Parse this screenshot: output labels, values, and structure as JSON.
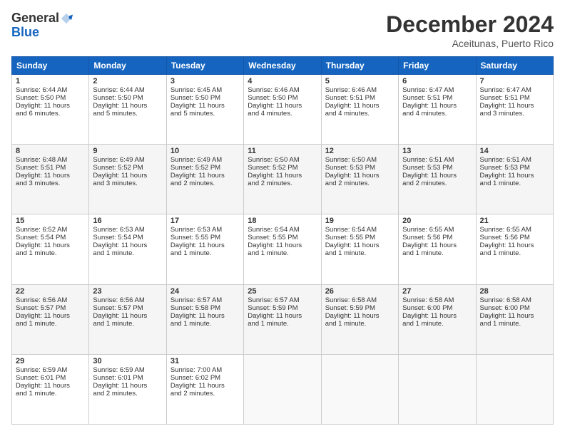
{
  "logo": {
    "general": "General",
    "blue": "Blue"
  },
  "header": {
    "month_year": "December 2024",
    "location": "Aceitunas, Puerto Rico"
  },
  "weekdays": [
    "Sunday",
    "Monday",
    "Tuesday",
    "Wednesday",
    "Thursday",
    "Friday",
    "Saturday"
  ],
  "weeks": [
    [
      {
        "day": "1",
        "lines": [
          "Sunrise: 6:44 AM",
          "Sunset: 5:50 PM",
          "Daylight: 11 hours",
          "and 6 minutes."
        ]
      },
      {
        "day": "2",
        "lines": [
          "Sunrise: 6:44 AM",
          "Sunset: 5:50 PM",
          "Daylight: 11 hours",
          "and 5 minutes."
        ]
      },
      {
        "day": "3",
        "lines": [
          "Sunrise: 6:45 AM",
          "Sunset: 5:50 PM",
          "Daylight: 11 hours",
          "and 5 minutes."
        ]
      },
      {
        "day": "4",
        "lines": [
          "Sunrise: 6:46 AM",
          "Sunset: 5:50 PM",
          "Daylight: 11 hours",
          "and 4 minutes."
        ]
      },
      {
        "day": "5",
        "lines": [
          "Sunrise: 6:46 AM",
          "Sunset: 5:51 PM",
          "Daylight: 11 hours",
          "and 4 minutes."
        ]
      },
      {
        "day": "6",
        "lines": [
          "Sunrise: 6:47 AM",
          "Sunset: 5:51 PM",
          "Daylight: 11 hours",
          "and 4 minutes."
        ]
      },
      {
        "day": "7",
        "lines": [
          "Sunrise: 6:47 AM",
          "Sunset: 5:51 PM",
          "Daylight: 11 hours",
          "and 3 minutes."
        ]
      }
    ],
    [
      {
        "day": "8",
        "lines": [
          "Sunrise: 6:48 AM",
          "Sunset: 5:51 PM",
          "Daylight: 11 hours",
          "and 3 minutes."
        ]
      },
      {
        "day": "9",
        "lines": [
          "Sunrise: 6:49 AM",
          "Sunset: 5:52 PM",
          "Daylight: 11 hours",
          "and 3 minutes."
        ]
      },
      {
        "day": "10",
        "lines": [
          "Sunrise: 6:49 AM",
          "Sunset: 5:52 PM",
          "Daylight: 11 hours",
          "and 2 minutes."
        ]
      },
      {
        "day": "11",
        "lines": [
          "Sunrise: 6:50 AM",
          "Sunset: 5:52 PM",
          "Daylight: 11 hours",
          "and 2 minutes."
        ]
      },
      {
        "day": "12",
        "lines": [
          "Sunrise: 6:50 AM",
          "Sunset: 5:53 PM",
          "Daylight: 11 hours",
          "and 2 minutes."
        ]
      },
      {
        "day": "13",
        "lines": [
          "Sunrise: 6:51 AM",
          "Sunset: 5:53 PM",
          "Daylight: 11 hours",
          "and 2 minutes."
        ]
      },
      {
        "day": "14",
        "lines": [
          "Sunrise: 6:51 AM",
          "Sunset: 5:53 PM",
          "Daylight: 11 hours",
          "and 1 minute."
        ]
      }
    ],
    [
      {
        "day": "15",
        "lines": [
          "Sunrise: 6:52 AM",
          "Sunset: 5:54 PM",
          "Daylight: 11 hours",
          "and 1 minute."
        ]
      },
      {
        "day": "16",
        "lines": [
          "Sunrise: 6:53 AM",
          "Sunset: 5:54 PM",
          "Daylight: 11 hours",
          "and 1 minute."
        ]
      },
      {
        "day": "17",
        "lines": [
          "Sunrise: 6:53 AM",
          "Sunset: 5:55 PM",
          "Daylight: 11 hours",
          "and 1 minute."
        ]
      },
      {
        "day": "18",
        "lines": [
          "Sunrise: 6:54 AM",
          "Sunset: 5:55 PM",
          "Daylight: 11 hours",
          "and 1 minute."
        ]
      },
      {
        "day": "19",
        "lines": [
          "Sunrise: 6:54 AM",
          "Sunset: 5:55 PM",
          "Daylight: 11 hours",
          "and 1 minute."
        ]
      },
      {
        "day": "20",
        "lines": [
          "Sunrise: 6:55 AM",
          "Sunset: 5:56 PM",
          "Daylight: 11 hours",
          "and 1 minute."
        ]
      },
      {
        "day": "21",
        "lines": [
          "Sunrise: 6:55 AM",
          "Sunset: 5:56 PM",
          "Daylight: 11 hours",
          "and 1 minute."
        ]
      }
    ],
    [
      {
        "day": "22",
        "lines": [
          "Sunrise: 6:56 AM",
          "Sunset: 5:57 PM",
          "Daylight: 11 hours",
          "and 1 minute."
        ]
      },
      {
        "day": "23",
        "lines": [
          "Sunrise: 6:56 AM",
          "Sunset: 5:57 PM",
          "Daylight: 11 hours",
          "and 1 minute."
        ]
      },
      {
        "day": "24",
        "lines": [
          "Sunrise: 6:57 AM",
          "Sunset: 5:58 PM",
          "Daylight: 11 hours",
          "and 1 minute."
        ]
      },
      {
        "day": "25",
        "lines": [
          "Sunrise: 6:57 AM",
          "Sunset: 5:59 PM",
          "Daylight: 11 hours",
          "and 1 minute."
        ]
      },
      {
        "day": "26",
        "lines": [
          "Sunrise: 6:58 AM",
          "Sunset: 5:59 PM",
          "Daylight: 11 hours",
          "and 1 minute."
        ]
      },
      {
        "day": "27",
        "lines": [
          "Sunrise: 6:58 AM",
          "Sunset: 6:00 PM",
          "Daylight: 11 hours",
          "and 1 minute."
        ]
      },
      {
        "day": "28",
        "lines": [
          "Sunrise: 6:58 AM",
          "Sunset: 6:00 PM",
          "Daylight: 11 hours",
          "and 1 minute."
        ]
      }
    ],
    [
      {
        "day": "29",
        "lines": [
          "Sunrise: 6:59 AM",
          "Sunset: 6:01 PM",
          "Daylight: 11 hours",
          "and 1 minute."
        ]
      },
      {
        "day": "30",
        "lines": [
          "Sunrise: 6:59 AM",
          "Sunset: 6:01 PM",
          "Daylight: 11 hours",
          "and 2 minutes."
        ]
      },
      {
        "day": "31",
        "lines": [
          "Sunrise: 7:00 AM",
          "Sunset: 6:02 PM",
          "Daylight: 11 hours",
          "and 2 minutes."
        ]
      },
      {
        "day": "",
        "lines": []
      },
      {
        "day": "",
        "lines": []
      },
      {
        "day": "",
        "lines": []
      },
      {
        "day": "",
        "lines": []
      }
    ]
  ]
}
